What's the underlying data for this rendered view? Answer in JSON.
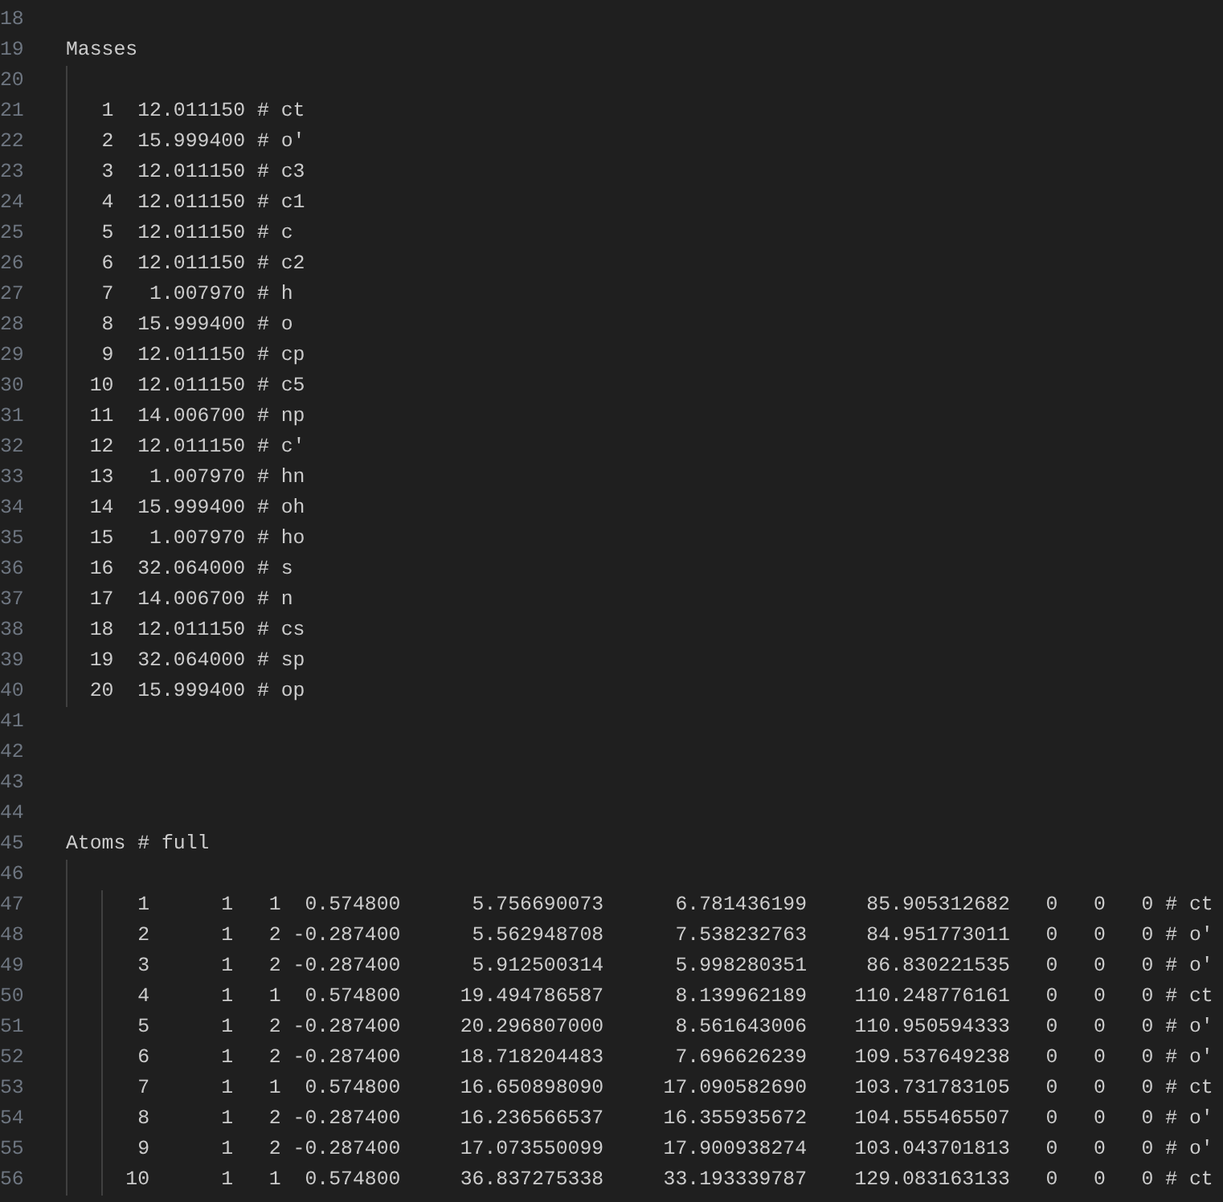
{
  "editor": {
    "lines": [
      {
        "number": "18"
      },
      {
        "number": "19",
        "text": "Masses"
      },
      {
        "number": "20"
      },
      {
        "number": "21",
        "text": "   1  12.011150 # ct"
      },
      {
        "number": "22",
        "text": "   2  15.999400 # o'"
      },
      {
        "number": "23",
        "text": "   3  12.011150 # c3"
      },
      {
        "number": "24",
        "text": "   4  12.011150 # c1"
      },
      {
        "number": "25",
        "text": "   5  12.011150 # c"
      },
      {
        "number": "26",
        "text": "   6  12.011150 # c2"
      },
      {
        "number": "27",
        "text": "   7   1.007970 # h"
      },
      {
        "number": "28",
        "text": "   8  15.999400 # o"
      },
      {
        "number": "29",
        "text": "   9  12.011150 # cp"
      },
      {
        "number": "30",
        "text": "  10  12.011150 # c5"
      },
      {
        "number": "31",
        "text": "  11  14.006700 # np"
      },
      {
        "number": "32",
        "text": "  12  12.011150 # c'"
      },
      {
        "number": "33",
        "text": "  13   1.007970 # hn"
      },
      {
        "number": "34",
        "text": "  14  15.999400 # oh"
      },
      {
        "number": "35",
        "text": "  15   1.007970 # ho"
      },
      {
        "number": "36",
        "text": "  16  32.064000 # s"
      },
      {
        "number": "37",
        "text": "  17  14.006700 # n"
      },
      {
        "number": "38",
        "text": "  18  12.011150 # cs"
      },
      {
        "number": "39",
        "text": "  19  32.064000 # sp"
      },
      {
        "number": "40",
        "text": "  20  15.999400 # op"
      },
      {
        "number": "41"
      },
      {
        "number": "42"
      },
      {
        "number": "43"
      },
      {
        "number": "44"
      },
      {
        "number": "45",
        "text": "Atoms # full"
      },
      {
        "number": "46"
      },
      {
        "number": "47",
        "text": "      1      1   1  0.574800      5.756690073      6.781436199     85.905312682   0   0   0 # ct"
      },
      {
        "number": "48",
        "text": "      2      1   2 -0.287400      5.562948708      7.538232763     84.951773011   0   0   0 # o'"
      },
      {
        "number": "49",
        "text": "      3      1   2 -0.287400      5.912500314      5.998280351     86.830221535   0   0   0 # o'"
      },
      {
        "number": "50",
        "text": "      4      1   1  0.574800     19.494786587      8.139962189    110.248776161   0   0   0 # ct"
      },
      {
        "number": "51",
        "text": "      5      1   2 -0.287400     20.296807000      8.561643006    110.950594333   0   0   0 # o'"
      },
      {
        "number": "52",
        "text": "      6      1   2 -0.287400     18.718204483      7.696626239    109.537649238   0   0   0 # o'"
      },
      {
        "number": "53",
        "text": "      7      1   1  0.574800     16.650898090     17.090582690    103.731783105   0   0   0 # ct"
      },
      {
        "number": "54",
        "text": "      8      1   2 -0.287400     16.236566537     16.355935672    104.555465507   0   0   0 # o'"
      },
      {
        "number": "55",
        "text": "      9      1   2 -0.287400     17.073550099     17.900938274    103.043701813   0   0   0 # o'"
      },
      {
        "number": "56",
        "text": "     10      1   1  0.574800     36.837275338     33.193339787    129.083163133   0   0   0 # ct"
      }
    ]
  }
}
